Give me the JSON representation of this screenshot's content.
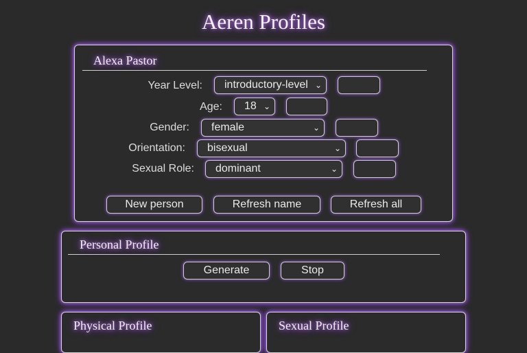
{
  "app": {
    "title": "Aeren Profiles"
  },
  "person_panel": {
    "name": "Alexa Pastor",
    "fields": [
      {
        "label": "Year Level:",
        "value": "introductory-level"
      },
      {
        "label": "Age:",
        "value": "18"
      },
      {
        "label": "Gender:",
        "value": "female"
      },
      {
        "label": "Orientation:",
        "value": "bisexual"
      },
      {
        "label": "Sexual Role:",
        "value": "dominant"
      }
    ],
    "randomize_glyph": "",
    "buttons": {
      "new_person": "New person",
      "refresh_name": "Refresh name",
      "refresh_all": "Refresh all"
    }
  },
  "personal_profile": {
    "title": "Personal Profile",
    "generate_label": "Generate",
    "stop_label": "Stop"
  },
  "physical_profile": {
    "title": "Physical Profile"
  },
  "sexual_profile": {
    "title": "Sexual Profile"
  }
}
